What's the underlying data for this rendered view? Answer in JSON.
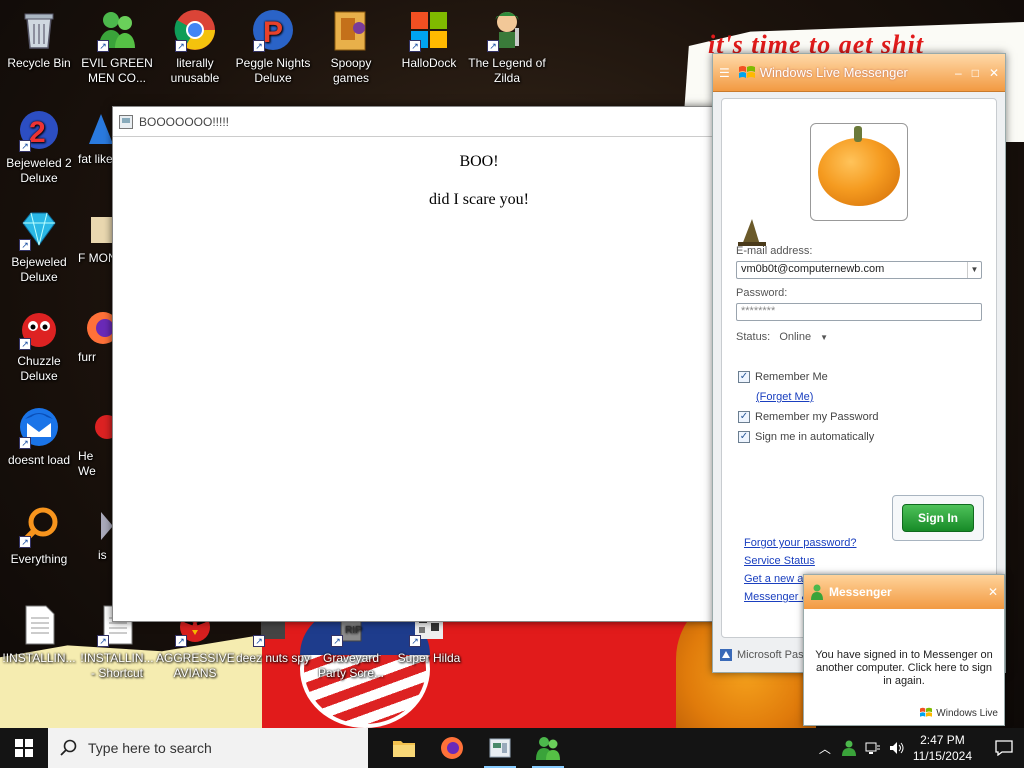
{
  "wallpaper": {
    "banner_text": "it's time to get shit"
  },
  "desktop_icons": [
    {
      "label": "Recycle Bin",
      "icon": "recycle-bin-icon"
    },
    {
      "label": "EVIL GREEN MEN CO...",
      "icon": "messenger-people-icon"
    },
    {
      "label": "literally unusable",
      "icon": "chrome-icon"
    },
    {
      "label": "Peggle Nights Deluxe",
      "icon": "peggle-icon"
    },
    {
      "label": "Spoopy games",
      "icon": "folder-icon"
    },
    {
      "label": "HalloDock",
      "icon": "microsoft-logo-icon"
    },
    {
      "label": "The Legend of Zilda",
      "icon": "zilda-icon"
    },
    {
      "label": "Bejeweled 2 Deluxe",
      "icon": "bejeweled2-icon"
    },
    {
      "label": "fat like",
      "icon": "app-icon"
    },
    {
      "label": "Bejeweled Deluxe",
      "icon": "bejeweled-icon"
    },
    {
      "label": "F MON",
      "icon": "app-icon"
    },
    {
      "label": "Chuzzle Deluxe",
      "icon": "chuzzle-icon"
    },
    {
      "label": "furr",
      "icon": "firefox-icon"
    },
    {
      "label": "doesnt load",
      "icon": "thunderbird-icon"
    },
    {
      "label": "He We",
      "icon": "app-icon"
    },
    {
      "label": "Everything",
      "icon": "everything-search-icon"
    },
    {
      "label": "is",
      "icon": "app-icon"
    },
    {
      "label": "!INSTALLIN...",
      "icon": "document-icon"
    },
    {
      "label": "!INSTALLIN... - Shortcut",
      "icon": "document-icon"
    },
    {
      "label": "AGGRESSIVE AVIANS",
      "icon": "angry-bird-icon"
    },
    {
      "label": "deez nuts spy",
      "icon": "spy-icon"
    },
    {
      "label": "Graveyard Party Scre...",
      "icon": "graveyard-icon"
    },
    {
      "label": "Super Hilda",
      "icon": "hilda-icon"
    }
  ],
  "boo_window": {
    "title": "BOOOOOOO!!!!!",
    "line1": "BOO!",
    "line2": "did I scare you!"
  },
  "messenger": {
    "title": "Windows Live Messenger",
    "email_label": "E-mail address:",
    "email_value": "vm0b0t@computernewb.com",
    "password_label": "Password:",
    "password_value": "********",
    "status_label": "Status:",
    "status_value": "Online",
    "remember_me": "Remember Me",
    "forget_me": "(Forget Me)",
    "remember_password": "Remember my Password",
    "sign_in_auto": "Sign me in automatically",
    "sign_in_button": "Sign In",
    "forgot_password": "Forgot your password?",
    "service_status": "Service Status",
    "get_new_account": "Get a new a",
    "messenger_link": "Messenger &",
    "footer": "Microsoft Pas"
  },
  "toast": {
    "title": "Messenger",
    "message": "You have signed in to Messenger on another computer. Click here to sign in again.",
    "brand": "Windows Live"
  },
  "taskbar": {
    "search_placeholder": "Type here to search",
    "time": "2:47 PM",
    "date": "11/15/2024"
  },
  "colors": {
    "accent_orange": "#f29a42",
    "signin_green": "#178a27",
    "link_blue": "#1a3fbf",
    "wallpaper_red": "#e11b1b"
  }
}
